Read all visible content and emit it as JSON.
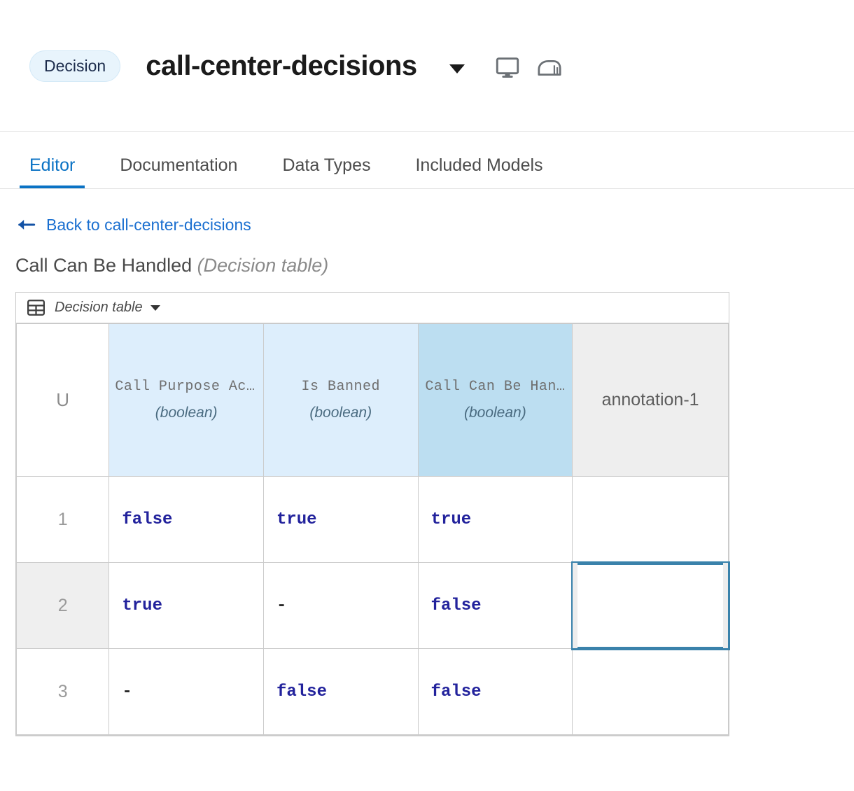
{
  "header": {
    "badge_label": "Decision",
    "model_name": "call-center-decisions",
    "dropdown_icon": "chevron-down-icon",
    "screen_icon": "monitor-icon",
    "deploy_icon": "server-icon"
  },
  "tabs": [
    {
      "label": "Editor",
      "active": true
    },
    {
      "label": "Documentation",
      "active": false
    },
    {
      "label": "Data Types",
      "active": false
    },
    {
      "label": "Included Models",
      "active": false
    }
  ],
  "breadcrumb": {
    "back_icon": "arrow-left-icon",
    "back_label": "Back to call-center-decisions"
  },
  "node": {
    "title": "Call Can Be Handled",
    "kind": "(Decision table)"
  },
  "decision_table": {
    "toolbar": {
      "grid_icon": "table-grid-icon",
      "label": "Decision table",
      "caret_icon": "caret-down-icon"
    },
    "hit_policy": "U",
    "columns": [
      {
        "name": "Call Purpose Accepted",
        "type": "(boolean)",
        "role": "input"
      },
      {
        "name": "Is Banned",
        "type": "(boolean)",
        "role": "input"
      },
      {
        "name": "Call Can Be Han…",
        "type": "(boolean)",
        "role": "output"
      }
    ],
    "annotation_header": "annotation-1",
    "rows": [
      {
        "number": "1",
        "values": [
          "false",
          "true",
          "true"
        ],
        "annotation": "",
        "selected": false
      },
      {
        "number": "2",
        "values": [
          "true",
          "-",
          "false"
        ],
        "annotation": "",
        "selected": true
      },
      {
        "number": "3",
        "values": [
          "-",
          "false",
          "false"
        ],
        "annotation": "",
        "selected": false
      }
    ]
  },
  "colors": {
    "accent_blue": "#0a72c4",
    "link_blue": "#1a6fd0",
    "input_column_bg": "#ddeefc",
    "output_column_bg": "#bcdef1",
    "annotation_header_bg": "#eeeeee",
    "selection_border": "#3a82ab",
    "value_text": "#22229c",
    "selected_row_bg": "#efefef"
  }
}
